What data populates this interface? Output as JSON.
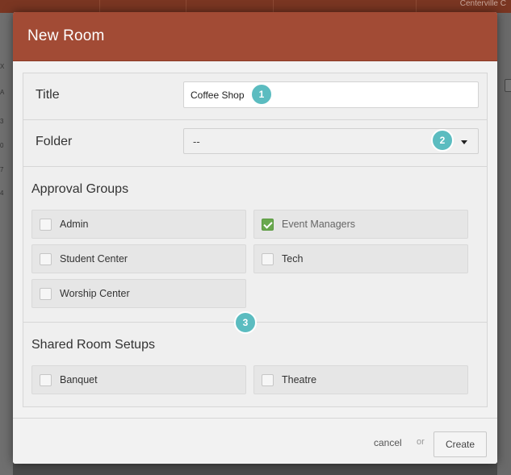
{
  "background": {
    "topbar_right_text": "Centerville C",
    "left_letters": [
      "X",
      "A",
      "3",
      "0",
      "7",
      "4"
    ]
  },
  "modal": {
    "title": "New Room",
    "fields": {
      "title_label": "Title",
      "title_value": "Coffee Shop",
      "folder_label": "Folder",
      "folder_value": "--"
    },
    "approval_groups": {
      "heading": "Approval Groups",
      "items": [
        {
          "label": "Admin",
          "checked": false
        },
        {
          "label": "Event Managers",
          "checked": true
        },
        {
          "label": "Student Center",
          "checked": false
        },
        {
          "label": "Tech",
          "checked": false
        },
        {
          "label": "Worship Center",
          "checked": false
        }
      ]
    },
    "shared_setups": {
      "heading": "Shared Room Setups",
      "items": [
        {
          "label": "Banquet",
          "checked": false
        },
        {
          "label": "Theatre",
          "checked": false
        }
      ]
    },
    "badges": [
      "1",
      "2",
      "3"
    ],
    "footer": {
      "cancel_label": "cancel",
      "or_label": "or",
      "create_label": "Create"
    }
  },
  "colors": {
    "header": "#a24b35",
    "badge": "#5bbcc0",
    "check": "#6aa84f"
  }
}
